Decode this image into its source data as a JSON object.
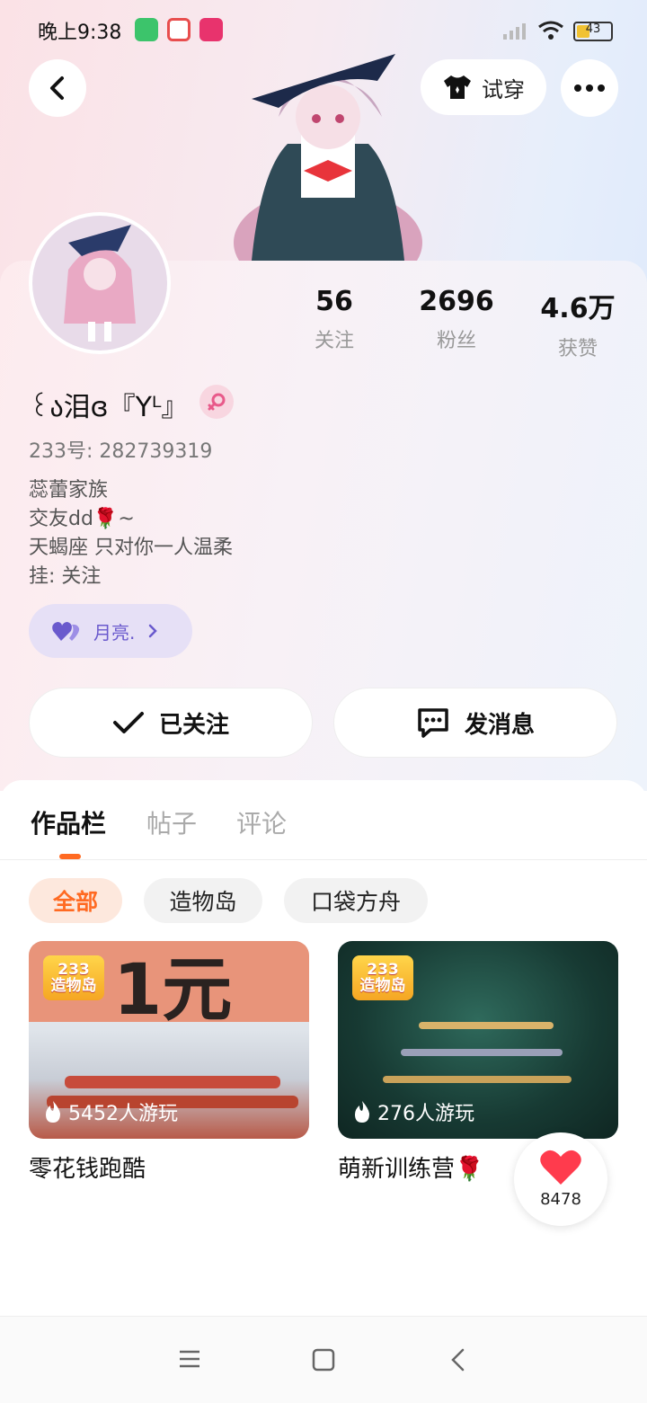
{
  "status_bar": {
    "time": "晚上9:38",
    "battery": "43",
    "battery_level": 0.43
  },
  "header": {
    "tryon_label": "试穿"
  },
  "stats": [
    {
      "value": "56",
      "label": "关注"
    },
    {
      "value": "2696",
      "label": "粉丝"
    },
    {
      "value": "4.6万",
      "label": "获赞"
    }
  ],
  "profile": {
    "nickname": "꒰ა泪ɞ『Yᴸ』",
    "uid": "233号: 282739319",
    "bio": [
      "蕊蕾家族",
      "交友dd🌹~",
      "天蝎座 只对你一人温柔",
      "挂: 关注"
    ],
    "moon_label": "月亮."
  },
  "actions": {
    "follow_label": "已关注",
    "message_label": "发消息"
  },
  "tabs": [
    "作品栏",
    "帖子",
    "评论"
  ],
  "chips": [
    "全部",
    "造物岛",
    "口袋方舟"
  ],
  "games": [
    {
      "plays": "5452人游玩",
      "title": "零花钱跑酷",
      "banner_text": "1元",
      "logo_top": "233",
      "logo_bottom": "造物岛"
    },
    {
      "plays": "276人游玩",
      "title": "萌新训练营🌹",
      "logo_top": "233",
      "logo_bottom": "造物岛"
    }
  ],
  "like": {
    "count": "8478"
  },
  "colors": {
    "accent": "#ff6a22",
    "heart": "#ff3b4d",
    "moon": "#6a5acd"
  }
}
